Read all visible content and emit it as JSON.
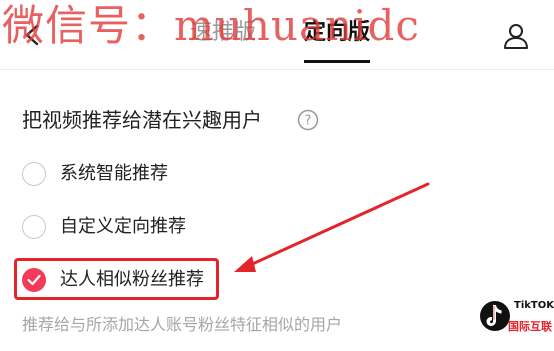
{
  "header": {
    "tabs": [
      {
        "label": "速推版",
        "active": false
      },
      {
        "label": "定向版",
        "active": true
      }
    ]
  },
  "watermark": "微信号：muhuanidc",
  "section": {
    "title": "把视频推荐给潜在兴趣用户"
  },
  "options": [
    {
      "label": "系统智能推荐",
      "checked": false
    },
    {
      "label": "自定义定向推荐",
      "checked": false
    },
    {
      "label": "达人相似粉丝推荐",
      "checked": true
    }
  ],
  "description": "推荐给与所添加达人账号粉丝特征相似的用户",
  "logo": {
    "brand": "TikTOK",
    "subtitle": "国际互联"
  },
  "colors": {
    "accent": "#f23b5b",
    "annotation": "#e4242b"
  },
  "icons": {
    "back": "chevron-left-icon",
    "profile": "user-icon",
    "help": "question-circle-icon",
    "check": "check-icon"
  }
}
